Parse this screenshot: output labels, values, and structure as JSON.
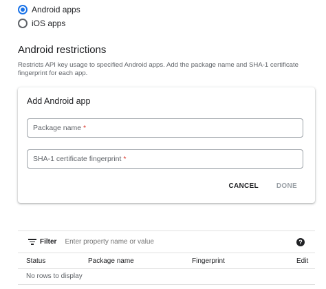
{
  "platform_options": [
    {
      "label": "Android apps",
      "selected": true
    },
    {
      "label": "iOS apps",
      "selected": false
    }
  ],
  "section": {
    "title": "Android restrictions",
    "description": "Restricts API key usage to specified Android apps. Add the package name and SHA-1 certificate fingerprint for each app."
  },
  "card": {
    "title": "Add Android app",
    "package_placeholder": "Package name",
    "fingerprint_placeholder": "SHA-1 certificate fingerprint",
    "required_mark": "*",
    "cancel_label": "CANCEL",
    "done_label": "DONE"
  },
  "filter": {
    "label": "Filter",
    "placeholder": "Enter property name or value",
    "help_glyph": "?"
  },
  "table": {
    "columns": [
      "Status",
      "Package name",
      "Fingerprint",
      "Edit"
    ],
    "empty_message": "No rows to display"
  },
  "colors": {
    "accent": "#1a73e8",
    "required": "#d93025",
    "disabled": "#9aa0a6"
  }
}
